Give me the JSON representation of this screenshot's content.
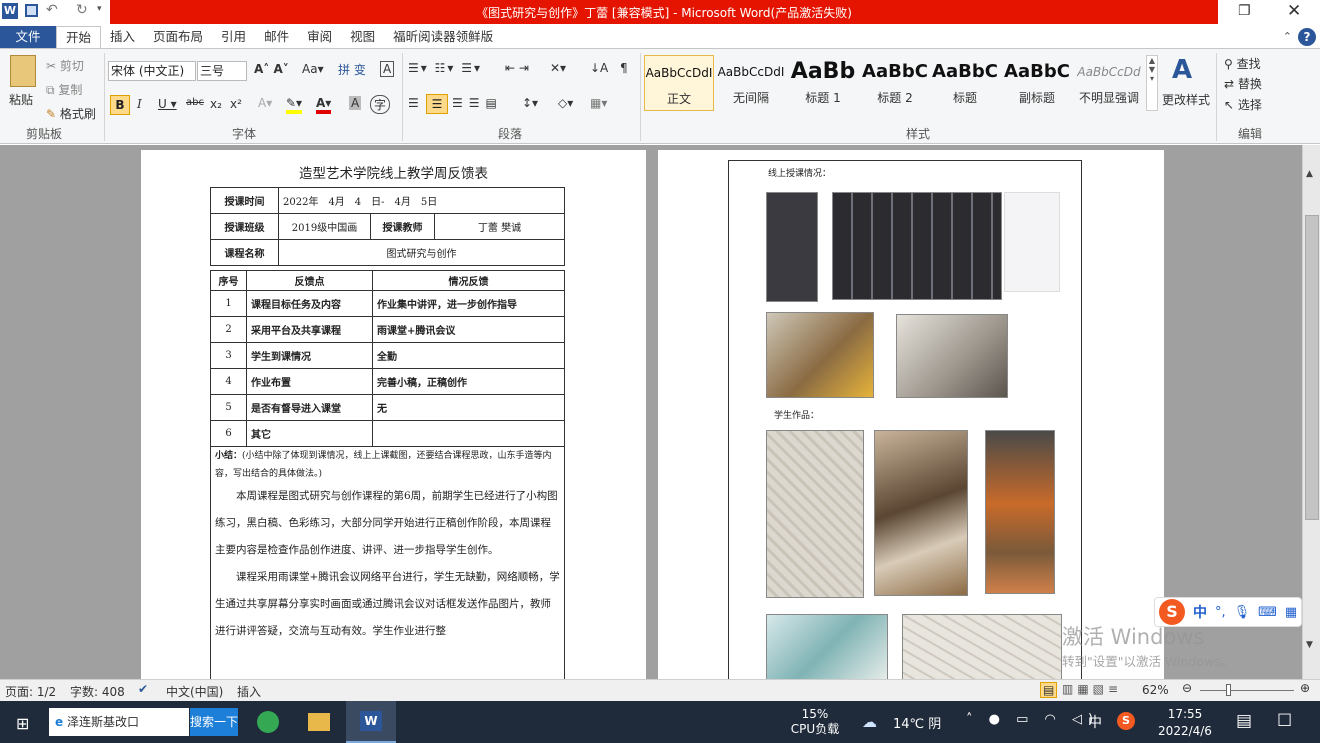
{
  "window": {
    "title": "《图式研究与创作》丁蕾 [兼容模式] - Microsoft Word(产品激活失败)"
  },
  "tabs": [
    "文件",
    "开始",
    "插入",
    "页面布局",
    "引用",
    "邮件",
    "审阅",
    "视图",
    "福昕阅读器领鲜版"
  ],
  "ribbon": {
    "clipboard": {
      "paste": "粘贴",
      "cut": "剪切",
      "copy": "复制",
      "format_painter": "格式刷",
      "label": "剪贴板"
    },
    "font": {
      "name": "宋体 (中文正)",
      "size": "三号",
      "label": "字体"
    },
    "paragraph": {
      "label": "段落"
    },
    "styles": {
      "label": "样式",
      "items": [
        {
          "sample": "AaBbCcDdI",
          "name": "正文"
        },
        {
          "sample": "AaBbCcDdI",
          "name": "无间隔"
        },
        {
          "sample": "AaBb",
          "name": "标题 1"
        },
        {
          "sample": "AaBbC",
          "name": "标题 2"
        },
        {
          "sample": "AaBbC",
          "name": "标题"
        },
        {
          "sample": "AaBbC",
          "name": "副标题"
        },
        {
          "sample": "AaBbCcDd",
          "name": "不明显强调"
        }
      ],
      "change": "更改样式"
    },
    "editing": {
      "find": "查找",
      "replace": "替换",
      "select": "选择",
      "label": "编辑"
    }
  },
  "doc": {
    "title": "造型艺术学院线上教学周反馈表",
    "rows": {
      "time_label": "授课时间",
      "time_value": "2022年　4月　4　日-　4月　5日",
      "class_label": "授课班级",
      "class_value": "2019级中国画",
      "teacher_label": "授课教师",
      "teacher_value": "丁蕾 樊诚",
      "course_label": "课程名称",
      "course_value": "图式研究与创作",
      "head": [
        "序号",
        "反馈点",
        "情况反馈"
      ],
      "items": [
        [
          "1",
          "课程目标任务及内容",
          "作业集中讲评，进一步创作指导"
        ],
        [
          "2",
          "采用平台及共享课程",
          "雨课堂+腾讯会议"
        ],
        [
          "3",
          "学生到课情况",
          "全勤"
        ],
        [
          "4",
          "作业布置",
          "完善小稿，正稿创作"
        ],
        [
          "5",
          "是否有督导进入课堂",
          "无"
        ],
        [
          "6",
          "其它",
          ""
        ]
      ]
    },
    "summary_label": "小结：",
    "summary_hint": "(小结中除了体现到课情况，线上上课截图，还要结合课程思政，山东手造等内容，写出结合的具体做法。)",
    "para1": "本周课程是图式研究与创作课程的第6周，前期学生已经进行了小构图练习，黑白稿、色彩练习，大部分同学开始进行正稿创作阶段，本周课程主要内容是检查作品创作进度、讲评、进一步指导学生创作。",
    "para2": "课程采用雨课堂+腾讯会议网络平台进行，学生无缺勤，网络顺畅，学生通过共享屏幕分享实时画面或通过腾讯会议对话框发送作品图片，教师进行讲评答疑，交流与互动有效。学生作业进行整",
    "page2_heading1": "线上授课情况：",
    "page2_heading2": "学生作品："
  },
  "watermark": {
    "line1": "激活 Windows",
    "line2": "转到\"设置\"以激活 Windows。"
  },
  "ime": {
    "lang": "中"
  },
  "status": {
    "page": "页面: 1/2",
    "words": "字数: 408",
    "language": "中文(中国)",
    "mode": "插入",
    "zoom": "62%"
  },
  "taskbar": {
    "browser": "泽连斯基改口",
    "search": "搜索一下",
    "cpu_pct": "15%",
    "cpu_label": "CPU负载",
    "weather": "14℃ 阴",
    "ime": "中",
    "time": "17:55",
    "date": "2022/4/6"
  }
}
